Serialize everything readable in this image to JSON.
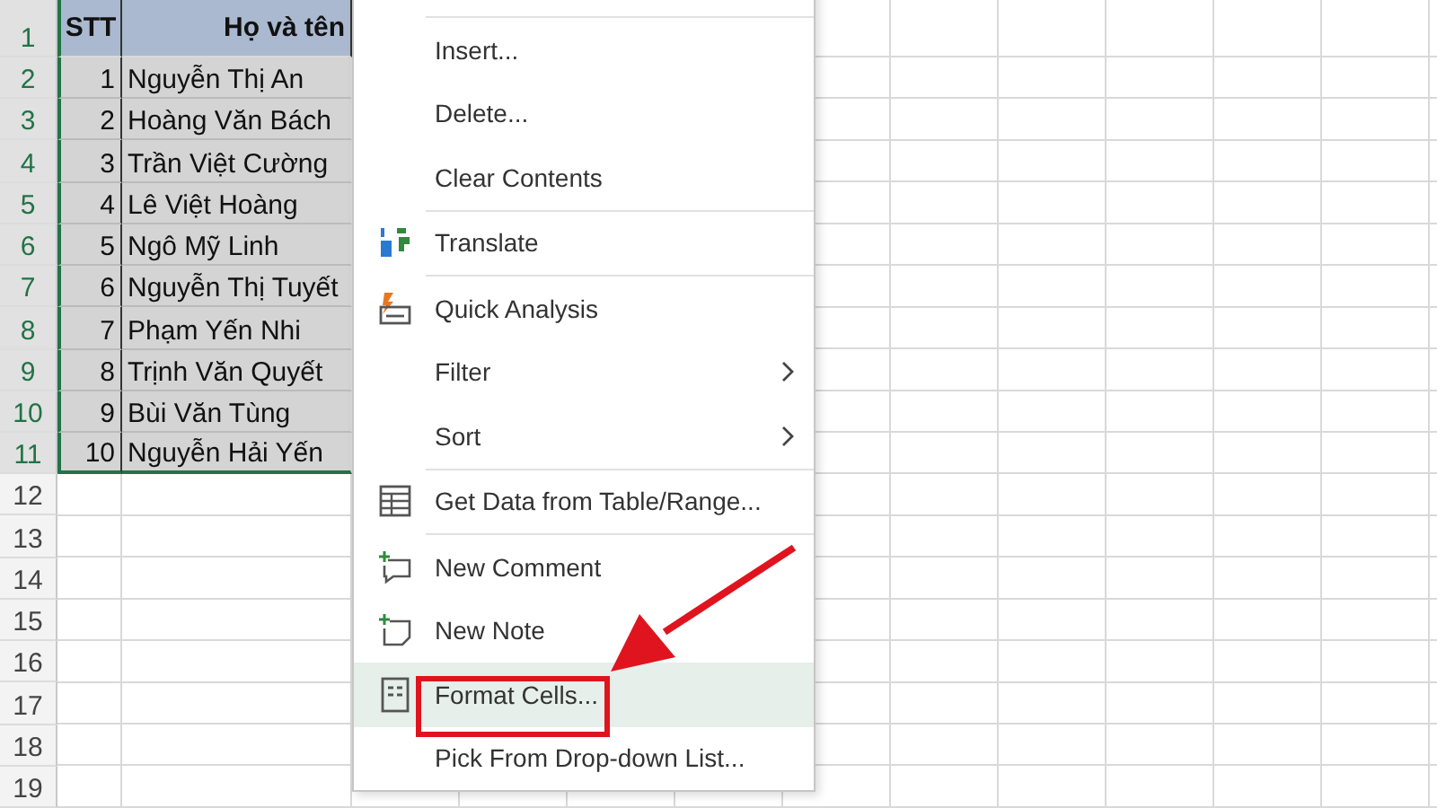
{
  "sheet": {
    "row_numbers": [
      {
        "label": "1",
        "selected": true
      },
      {
        "label": "2",
        "selected": true
      },
      {
        "label": "3",
        "selected": true
      },
      {
        "label": "4",
        "selected": true
      },
      {
        "label": "5",
        "selected": true
      },
      {
        "label": "6",
        "selected": true
      },
      {
        "label": "7",
        "selected": true
      },
      {
        "label": "8",
        "selected": true
      },
      {
        "label": "9",
        "selected": true
      },
      {
        "label": "10",
        "selected": true
      },
      {
        "label": "11",
        "selected": true
      },
      {
        "label": "12",
        "selected": false
      },
      {
        "label": "13",
        "selected": false
      },
      {
        "label": "14",
        "selected": false
      },
      {
        "label": "15",
        "selected": false
      },
      {
        "label": "16",
        "selected": false
      },
      {
        "label": "17",
        "selected": false
      },
      {
        "label": "18",
        "selected": false
      },
      {
        "label": "19",
        "selected": false
      }
    ],
    "header": [
      "STT",
      "Họ và tên"
    ],
    "rows": [
      [
        "1",
        "Nguyễn Thị An"
      ],
      [
        "2",
        "Hoàng Văn Bách"
      ],
      [
        "3",
        "Trần Việt Cường"
      ],
      [
        "4",
        "Lê Việt Hoàng"
      ],
      [
        "5",
        "Ngô Mỹ Linh"
      ],
      [
        "6",
        "Nguyễn Thị Tuyết"
      ],
      [
        "7",
        "Phạm Yến Nhi"
      ],
      [
        "8",
        "Trịnh Văn Quyết"
      ],
      [
        "9",
        "Bùi Văn Tùng"
      ],
      [
        "10",
        "Nguyễn Hải Yến"
      ]
    ]
  },
  "context_menu": {
    "items": [
      {
        "label": "Insert...",
        "kind": "plain",
        "separator_before": true,
        "selected": false
      },
      {
        "label": "Delete...",
        "kind": "plain",
        "separator_before": false,
        "selected": false
      },
      {
        "label": "Clear Contents",
        "kind": "plain",
        "separator_before": false,
        "selected": false
      },
      {
        "label": "Translate",
        "kind": "translate",
        "separator_before": true,
        "selected": false
      },
      {
        "label": "Quick Analysis",
        "kind": "analysis",
        "separator_before": true,
        "selected": false
      },
      {
        "label": "Filter",
        "kind": "submenu",
        "separator_before": false,
        "selected": false
      },
      {
        "label": "Sort",
        "kind": "submenu",
        "separator_before": false,
        "selected": false
      },
      {
        "label": "Get Data from Table/Range...",
        "kind": "table",
        "separator_before": true,
        "selected": false
      },
      {
        "label": "New Comment",
        "kind": "comment",
        "separator_before": true,
        "selected": false
      },
      {
        "label": "New Note",
        "kind": "note",
        "separator_before": false,
        "selected": false
      },
      {
        "label": "Format Cells...",
        "kind": "format",
        "separator_before": false,
        "selected": true
      },
      {
        "label": "Pick From Drop-down List...",
        "kind": "plain",
        "separator_before": false,
        "selected": false
      }
    ]
  }
}
